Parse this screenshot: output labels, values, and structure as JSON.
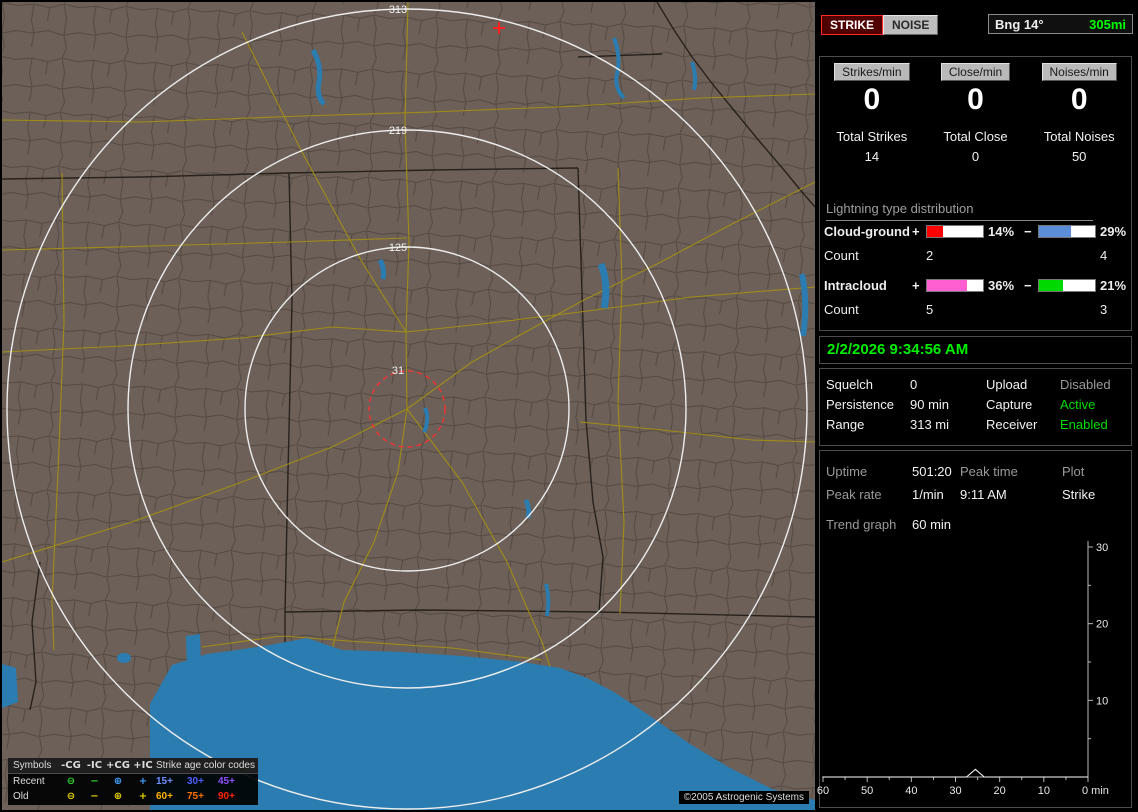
{
  "map": {
    "range_labels": [
      "313",
      "219",
      "125",
      "31"
    ],
    "copyright": "©2005 Astrogenic Systems",
    "legend": {
      "header_symbols": "Symbols",
      "header_cols": [
        "-CG",
        "-IC",
        "+CG",
        "+IC"
      ],
      "header_age": "Strike age color codes",
      "glyphs": [
        "⊖",
        "−",
        "⊕",
        "+"
      ],
      "icon_colors_recent": [
        "#2bd62b",
        "#2bd62b",
        "#41a0ff",
        "#41a0ff"
      ],
      "icon_colors_old": [
        "#e8d400",
        "#e8d400",
        "#e8d400",
        "#e8d400"
      ],
      "rows": [
        {
          "label": "Recent",
          "ages": [
            "15+",
            "30+",
            "45+"
          ]
        },
        {
          "label": "Old",
          "ages": [
            "60+",
            "75+",
            "90+"
          ]
        }
      ],
      "age_colors_recent": [
        "#6f8fff",
        "#4a5fff",
        "#8f4fff"
      ],
      "age_colors_old": [
        "#ffb400",
        "#ff7000",
        "#ff2200"
      ]
    }
  },
  "panel": {
    "strike_btn": "STRIKE",
    "noise_btn": "NOISE",
    "bearing_label": "Bng 14°",
    "bearing_range": "305mi",
    "rates": [
      {
        "label": "Strikes/min",
        "value": "0"
      },
      {
        "label": "Close/min",
        "value": "0"
      },
      {
        "label": "Noises/min",
        "value": "0"
      }
    ],
    "totals": [
      {
        "label": "Total Strikes",
        "value": "14"
      },
      {
        "label": "Total Close",
        "value": "0"
      },
      {
        "label": "Total Noises",
        "value": "50"
      }
    ],
    "distribution": {
      "title": "Lightning type distribution",
      "count_label": "Count",
      "pos_sign": "+",
      "neg_sign": "−",
      "rows": [
        {
          "label": "Cloud-ground",
          "pos_pct": "14%",
          "neg_pct": "29%",
          "pos_count": "2",
          "neg_count": "4",
          "pos_fill": 14,
          "neg_fill": 29,
          "pos_color": "#ff0000",
          "neg_color": "#5b8dd9"
        },
        {
          "label": "Intracloud",
          "pos_pct": "36%",
          "neg_pct": "21%",
          "pos_count": "5",
          "neg_count": "3",
          "pos_fill": 36,
          "neg_fill": 21,
          "pos_color": "#ff5fd0",
          "neg_color": "#00d900"
        }
      ]
    },
    "datetime": "2/2/2026 9:34:56 AM",
    "settings": [
      {
        "label": "Squelch",
        "value": "0",
        "label2": "Upload",
        "value2": "Disabled",
        "value2_color": "#9a9a9a"
      },
      {
        "label": "Persistence",
        "value": "90 min",
        "label2": "Capture",
        "value2": "Active",
        "value2_color": "#00dd00"
      },
      {
        "label": "Range",
        "value": "313 mi",
        "label2": "Receiver",
        "value2": "Enabled",
        "value2_color": "#00dd00"
      }
    ],
    "status": {
      "uptime_label": "Uptime",
      "uptime": "501:20",
      "peaktime_label": "Peak time",
      "peaktime": "9:11 AM",
      "plot_label": "Plot",
      "plot": "Strike",
      "peakrate_label": "Peak rate",
      "peakrate": "1/min",
      "trend_label": "Trend graph",
      "trend_value": "60 min"
    }
  },
  "chart_data": {
    "type": "line",
    "x_ticks": [
      60,
      50,
      40,
      30,
      20,
      10,
      0
    ],
    "x_unit": "min",
    "y_ticks": [
      30,
      20,
      10
    ],
    "ylim": [
      0,
      30
    ],
    "x_minutes_range": [
      60,
      0
    ],
    "series": [
      {
        "name": "Strike",
        "points": [
          [
            60,
            0
          ],
          [
            27.5,
            0
          ],
          [
            25.5,
            1
          ],
          [
            23.5,
            0
          ],
          [
            0,
            0
          ]
        ]
      }
    ]
  }
}
